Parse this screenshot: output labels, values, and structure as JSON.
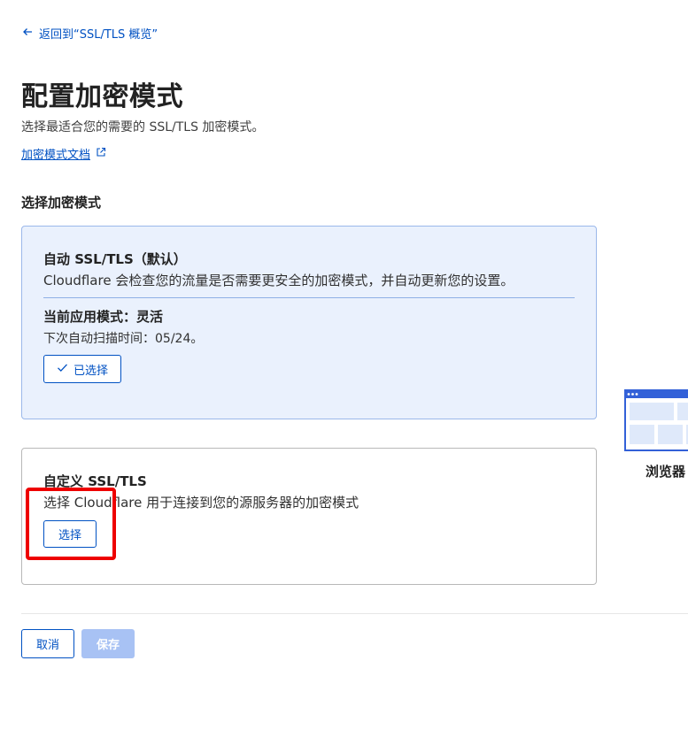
{
  "back_link": {
    "label": "返回到“SSL/TLS 概览”"
  },
  "header": {
    "title": "配置加密模式",
    "subtitle": "选择最适合您的需要的 SSL/TLS 加密模式。",
    "doc_link": "加密模式文档"
  },
  "section": {
    "label": "选择加密模式"
  },
  "auto_card": {
    "title": "自动 SSL/TLS（默认）",
    "description": "Cloudflare 会检查您的流量是否需要更安全的加密模式，并自动更新您的设置。",
    "current_mode": "当前应用模式：灵活",
    "next_scan": "下次自动扫描时间：05/24。",
    "selected_label": "已选择"
  },
  "custom_card": {
    "title": "自定义 SSL/TLS",
    "description": "选择 Cloudflare 用于连接到您的源服务器的加密模式",
    "select_label": "选择"
  },
  "illustration": {
    "label": "浏览器"
  },
  "footer": {
    "cancel_label": "取消",
    "save_label": "保存"
  },
  "colors": {
    "link": "#0051c3",
    "selected_card_bg": "#eaf1fd",
    "highlight": "#ee0000",
    "save_disabled": "#a8c2f4"
  }
}
